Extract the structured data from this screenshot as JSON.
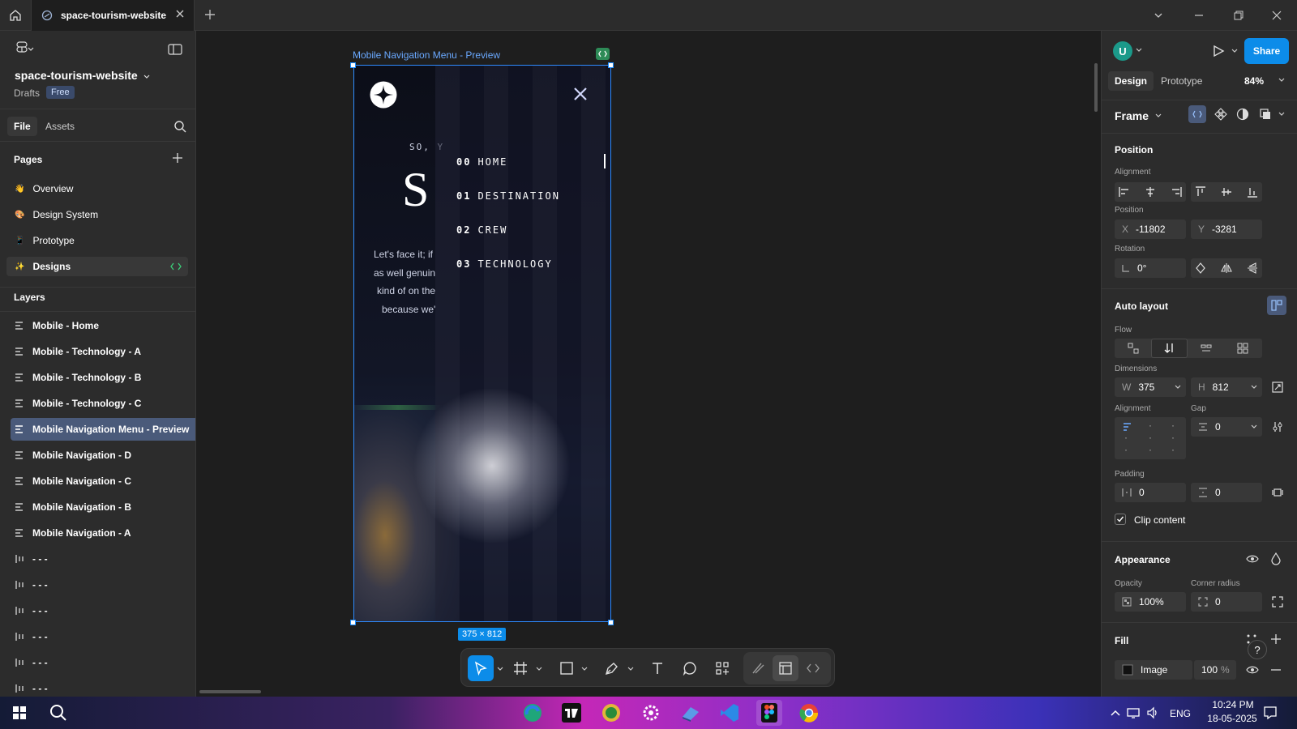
{
  "titlebar": {
    "tab_label": "space-tourism-website"
  },
  "left": {
    "project_name": "space-tourism-website",
    "drafts": "Drafts",
    "plan_badge": "Free",
    "tabs": [
      "File",
      "Assets"
    ],
    "pages_header": "Pages",
    "pages": [
      {
        "emoji": "👋",
        "label": "Overview"
      },
      {
        "emoji": "🎨",
        "label": "Design System"
      },
      {
        "emoji": "📱",
        "label": "Prototype"
      },
      {
        "emoji": "✨",
        "label": "Designs"
      }
    ],
    "layers_header": "Layers",
    "layers": [
      "Mobile - Home",
      "Mobile - Technology - A",
      "Mobile - Technology - B",
      "Mobile - Technology - C",
      "Mobile Navigation Menu - Preview",
      "Mobile Navigation - D",
      "Mobile Navigation - C",
      "Mobile Navigation - B",
      "Mobile Navigation - A",
      "- - -",
      "- - -",
      "- - -",
      "- - -",
      "- - -",
      "- - -"
    ]
  },
  "canvas": {
    "frame_label": "Mobile Navigation Menu - Preview",
    "size_badge": "375 × 812",
    "frame": {
      "subtitle_partial": "SO, Y",
      "title_partial": "S",
      "body_lines": [
        "Let's face it; if",
        "as well genuin",
        "kind of on the",
        "because we'"
      ],
      "nav": [
        {
          "num": "00",
          "label": "HOME"
        },
        {
          "num": "01",
          "label": "DESTINATION"
        },
        {
          "num": "02",
          "label": "CREW"
        },
        {
          "num": "03",
          "label": "TECHNOLOGY"
        }
      ]
    }
  },
  "right": {
    "avatar_letter": "U",
    "share_label": "Share",
    "tabs": [
      "Design",
      "Prototype"
    ],
    "zoom": "84%",
    "frame_type": "Frame",
    "position_header": "Position",
    "alignment_label": "Alignment",
    "position_label": "Position",
    "x_value": "-11802",
    "y_value": "-3281",
    "rotation_label": "Rotation",
    "rotation_value": "0°",
    "auto_layout_header": "Auto layout",
    "flow_label": "Flow",
    "dimensions_label": "Dimensions",
    "width": "375",
    "height": "812",
    "alignment2_label": "Alignment",
    "gap_label": "Gap",
    "gap_value": "0",
    "padding_label": "Padding",
    "padding_h": "0",
    "padding_v": "0",
    "clip_label": "Clip content",
    "appearance_header": "Appearance",
    "opacity_label": "Opacity",
    "opacity_value": "100%",
    "radius_label": "Corner radius",
    "radius_value": "0",
    "fill_header": "Fill",
    "fill_type": "Image",
    "fill_opacity": "100",
    "fill_pct": "%"
  },
  "taskbar": {
    "lang": "ENG",
    "time": "10:24 PM",
    "date": "18-05-2025"
  },
  "colors": {
    "accent": "#0c8ce9",
    "panel": "#2c2c2c",
    "canvas": "#1e1e1e",
    "selection": "#4a5a7a"
  }
}
